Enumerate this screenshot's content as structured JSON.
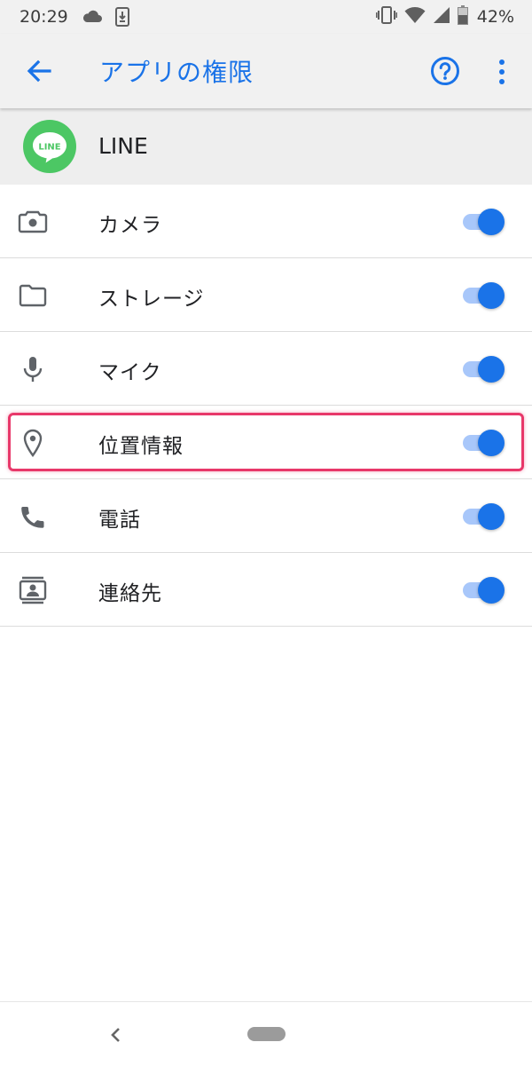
{
  "status_bar": {
    "time": "20:29",
    "battery_text": "42%",
    "icons": [
      "cloud-icon",
      "download-icon",
      "vibrate-icon",
      "wifi-icon",
      "signal-icon",
      "battery-icon"
    ]
  },
  "app_bar": {
    "title": "アプリの権限",
    "icons": [
      "back-arrow-icon",
      "help-icon",
      "overflow-menu-icon"
    ],
    "accent_color": "#1a73e8"
  },
  "app_header": {
    "name": "LINE",
    "logo_text": "LINE",
    "logo_color": "#4cc764"
  },
  "permissions": [
    {
      "label": "カメラ",
      "icon": "camera-icon",
      "enabled": true
    },
    {
      "label": "ストレージ",
      "icon": "folder-icon",
      "enabled": true
    },
    {
      "label": "マイク",
      "icon": "microphone-icon",
      "enabled": true
    },
    {
      "label": "位置情報",
      "icon": "location-pin-icon",
      "enabled": true,
      "highlighted": true
    },
    {
      "label": "電話",
      "icon": "phone-icon",
      "enabled": true
    },
    {
      "label": "連絡先",
      "icon": "contacts-icon",
      "enabled": true
    }
  ],
  "colors": {
    "toggle_on_thumb": "#1a73e8",
    "toggle_on_track": "#a8c7fa",
    "highlight_border": "#e8386a",
    "header_background": "#f1f1f1"
  },
  "nav_bar": {
    "icons": [
      "nav-back-icon",
      "home-pill-icon"
    ]
  }
}
